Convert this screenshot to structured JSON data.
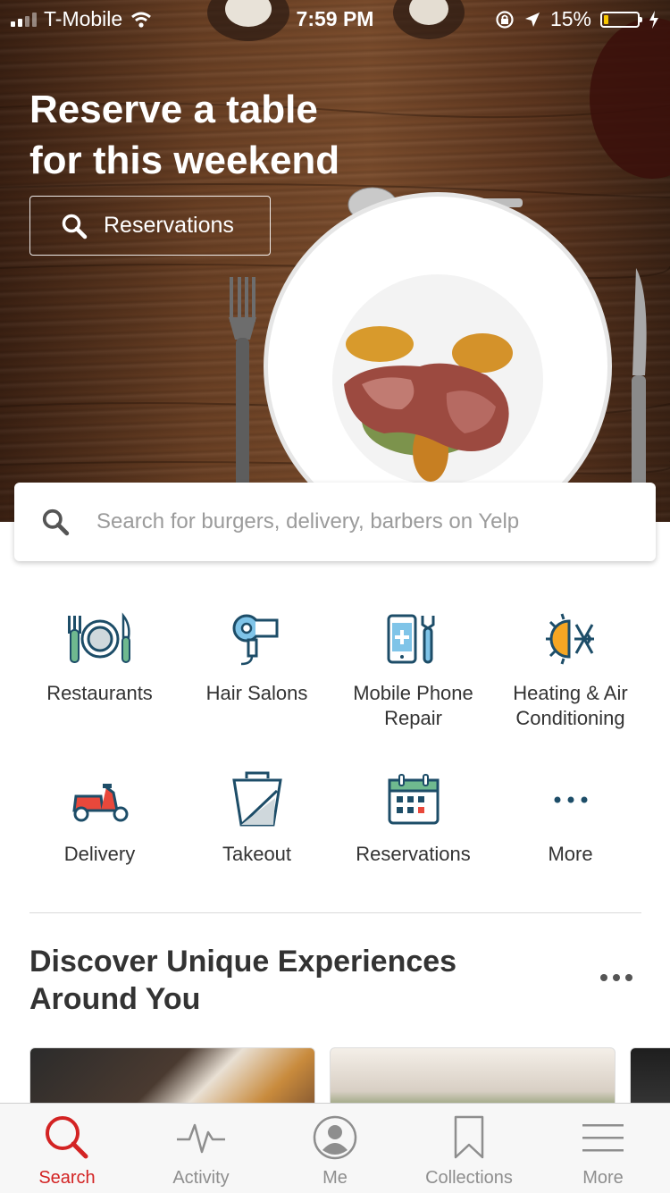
{
  "status_bar": {
    "carrier": "T-Mobile",
    "time": "7:59 PM",
    "battery": "15%",
    "battery_level": 0.15
  },
  "hero": {
    "title_line1": "Reserve a table",
    "title_line2": "for this weekend",
    "button_label": "Reservations"
  },
  "search": {
    "placeholder": "Search for burgers, delivery, barbers on Yelp"
  },
  "categories": [
    {
      "label": "Restaurants",
      "icon": "restaurant-icon"
    },
    {
      "label": "Hair Salons",
      "icon": "hair-dryer-icon"
    },
    {
      "label_line1": "Mobile Phone",
      "label_line2": "Repair",
      "icon": "phone-repair-icon"
    },
    {
      "label_line1": "Heating & Air",
      "label_line2": "Conditioning",
      "icon": "heating-air-icon"
    },
    {
      "label": "Delivery",
      "icon": "scooter-icon"
    },
    {
      "label": "Takeout",
      "icon": "takeout-box-icon"
    },
    {
      "label": "Reservations",
      "icon": "calendar-icon"
    },
    {
      "label": "More",
      "icon": "more-dots-icon"
    }
  ],
  "discover": {
    "title_line1": "Discover Unique Experiences",
    "title_line2": "Around You"
  },
  "tabs": [
    {
      "label": "Search",
      "icon": "search-icon",
      "active": true
    },
    {
      "label": "Activity",
      "icon": "activity-icon"
    },
    {
      "label": "Me",
      "icon": "profile-icon"
    },
    {
      "label": "Collections",
      "icon": "bookmark-icon"
    },
    {
      "label": "More",
      "icon": "menu-icon"
    }
  ],
  "colors": {
    "accent": "#d32323",
    "icon_blue": "#1d4d68",
    "icon_teal": "#3aa5a5"
  }
}
